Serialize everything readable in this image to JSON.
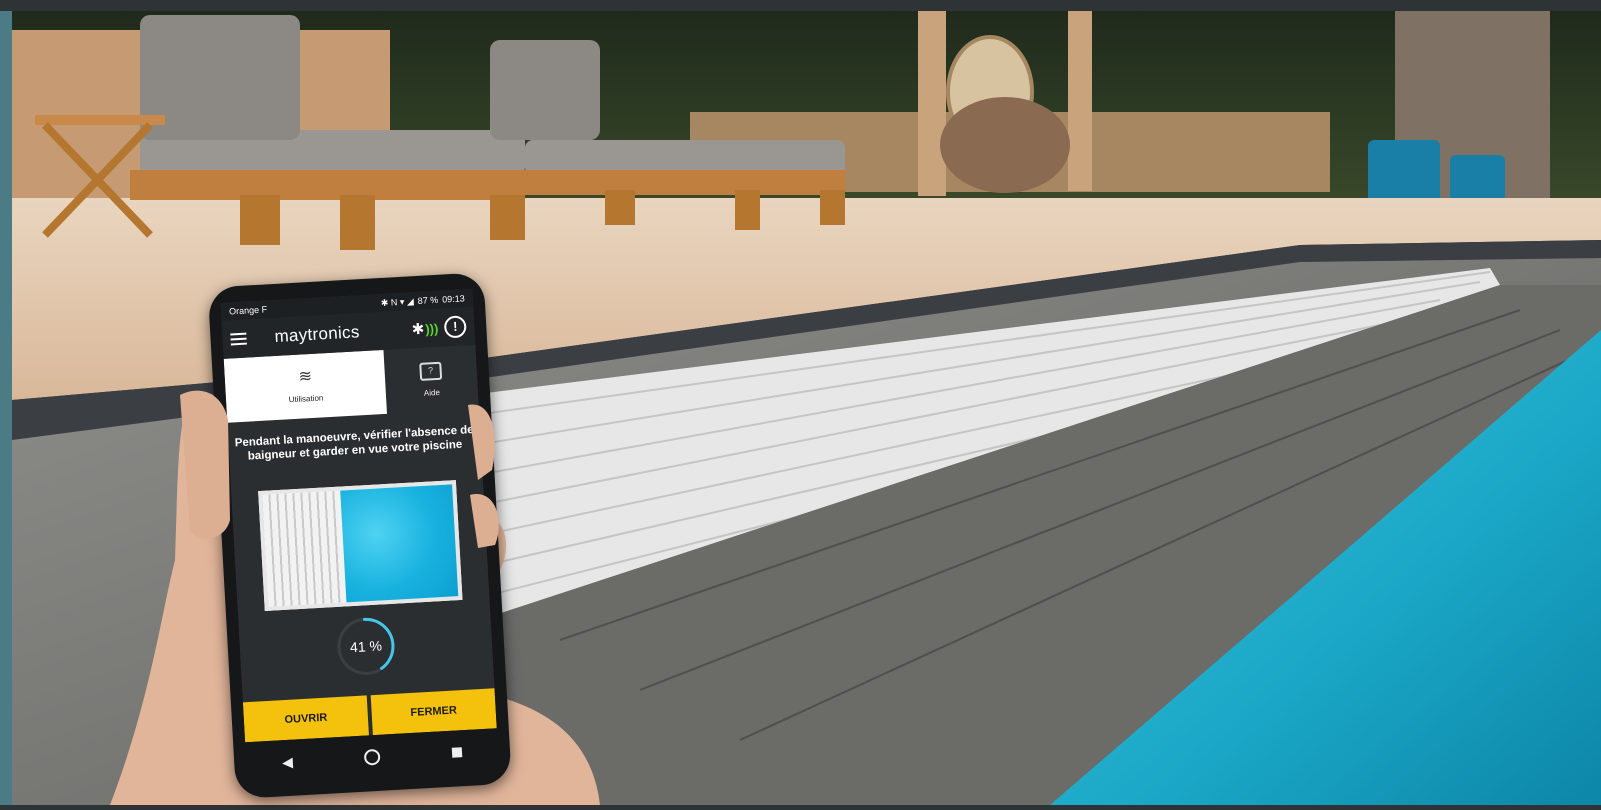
{
  "phone": {
    "status": {
      "carrier": "Orange F",
      "icons": "✱ N ▾ ◢",
      "battery": "87 %",
      "time": "09:13"
    },
    "app": {
      "brand": "maytronics",
      "bluetooth_icon": "bluetooth-icon",
      "alert_icon": "alert-icon"
    },
    "tabs": [
      {
        "label": "Utilisation",
        "icon": "waves-icon",
        "active": true
      },
      {
        "label": "Aide",
        "icon": "help-icon",
        "active": false
      }
    ],
    "warning": "Pendant la manoeuvre, vérifier l'absence de baigneur et garder en vue votre piscine",
    "progress": {
      "value_percent": 41,
      "label": "41 %"
    },
    "buttons": {
      "open": "OUVRIR",
      "close": "FERMER"
    },
    "colors": {
      "accent": "#f4c20d",
      "gauge": "#45c6e8",
      "bluetooth_wave": "#5bd32f"
    }
  }
}
